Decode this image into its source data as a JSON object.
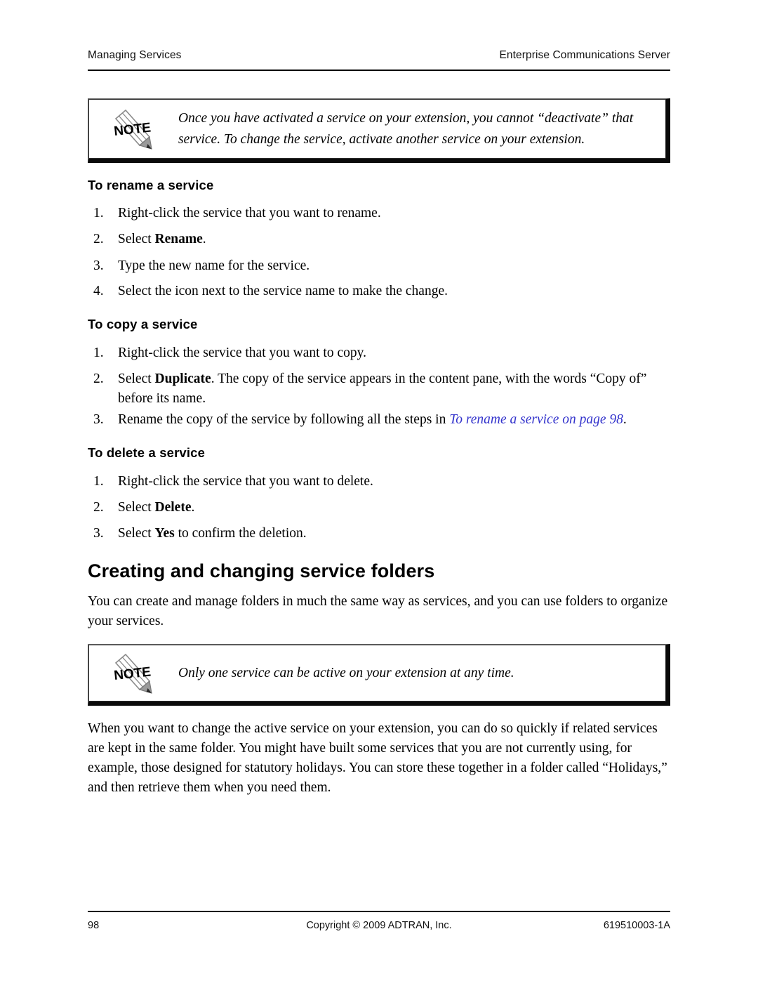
{
  "header": {
    "left": "Managing Services",
    "right": "Enterprise Communications Server"
  },
  "notes": [
    {
      "icon": "note-pencil-icon",
      "label": "NOTE",
      "text": "Once you have activated a service on your extension, you cannot “deactivate” that service. To change the service, activate another service on your extension."
    },
    {
      "icon": "note-pencil-icon",
      "label": "NOTE",
      "text": "Only one service can be active on your extension at any time."
    }
  ],
  "sections": {
    "rename": {
      "heading": "To rename a service",
      "steps": [
        {
          "num": "1.",
          "text": "Right-click the service that you want to rename."
        },
        {
          "num": "2.",
          "pre": "Select ",
          "bold": "Rename",
          "post": "."
        },
        {
          "num": "3.",
          "text": "Type the new name for the service."
        },
        {
          "num": "4.",
          "text": "Select the icon next to the service name to make the change."
        }
      ]
    },
    "copy": {
      "heading": "To copy a service",
      "steps": [
        {
          "num": "1.",
          "text": "Right-click the service that you want to copy."
        },
        {
          "num": "2.",
          "pre": "Select ",
          "bold": "Duplicate",
          "post": ". The copy of the service appears in the content pane, with the words “Copy of” before its name."
        },
        {
          "num": "3.",
          "pre": "Rename the copy of the service by following all the steps in ",
          "xref": "To rename a service on page 98",
          "post": "."
        }
      ]
    },
    "delete": {
      "heading": "To delete a service",
      "steps": [
        {
          "num": "1.",
          "text": "Right-click the service that you want to delete."
        },
        {
          "num": "2.",
          "pre": "Select ",
          "bold": "Delete",
          "post": "."
        },
        {
          "num": "3.",
          "pre": "Select ",
          "bold": "Yes",
          "post": " to confirm the deletion."
        }
      ]
    }
  },
  "folders_section": {
    "heading": "Creating and changing service folders",
    "intro": "You can create and manage folders in much the same way as services, and you can use folders to organize your services.",
    "body": "When you want to change the active service on your extension, you can do so quickly if related services are kept in the same folder. You might have built some services that you are not currently using, for example, those designed for statutory holidays. You can store these together in a folder called “Holidays,” and then retrieve them when you need them."
  },
  "footer": {
    "page_number": "98",
    "copyright": "Copyright © 2009 ADTRAN, Inc.",
    "doc_number": "619510003-1A"
  },
  "colors": {
    "xref_link": "#3333cc",
    "text": "#000000",
    "rule": "#000000",
    "note_shadow": "#0a0a0a"
  }
}
